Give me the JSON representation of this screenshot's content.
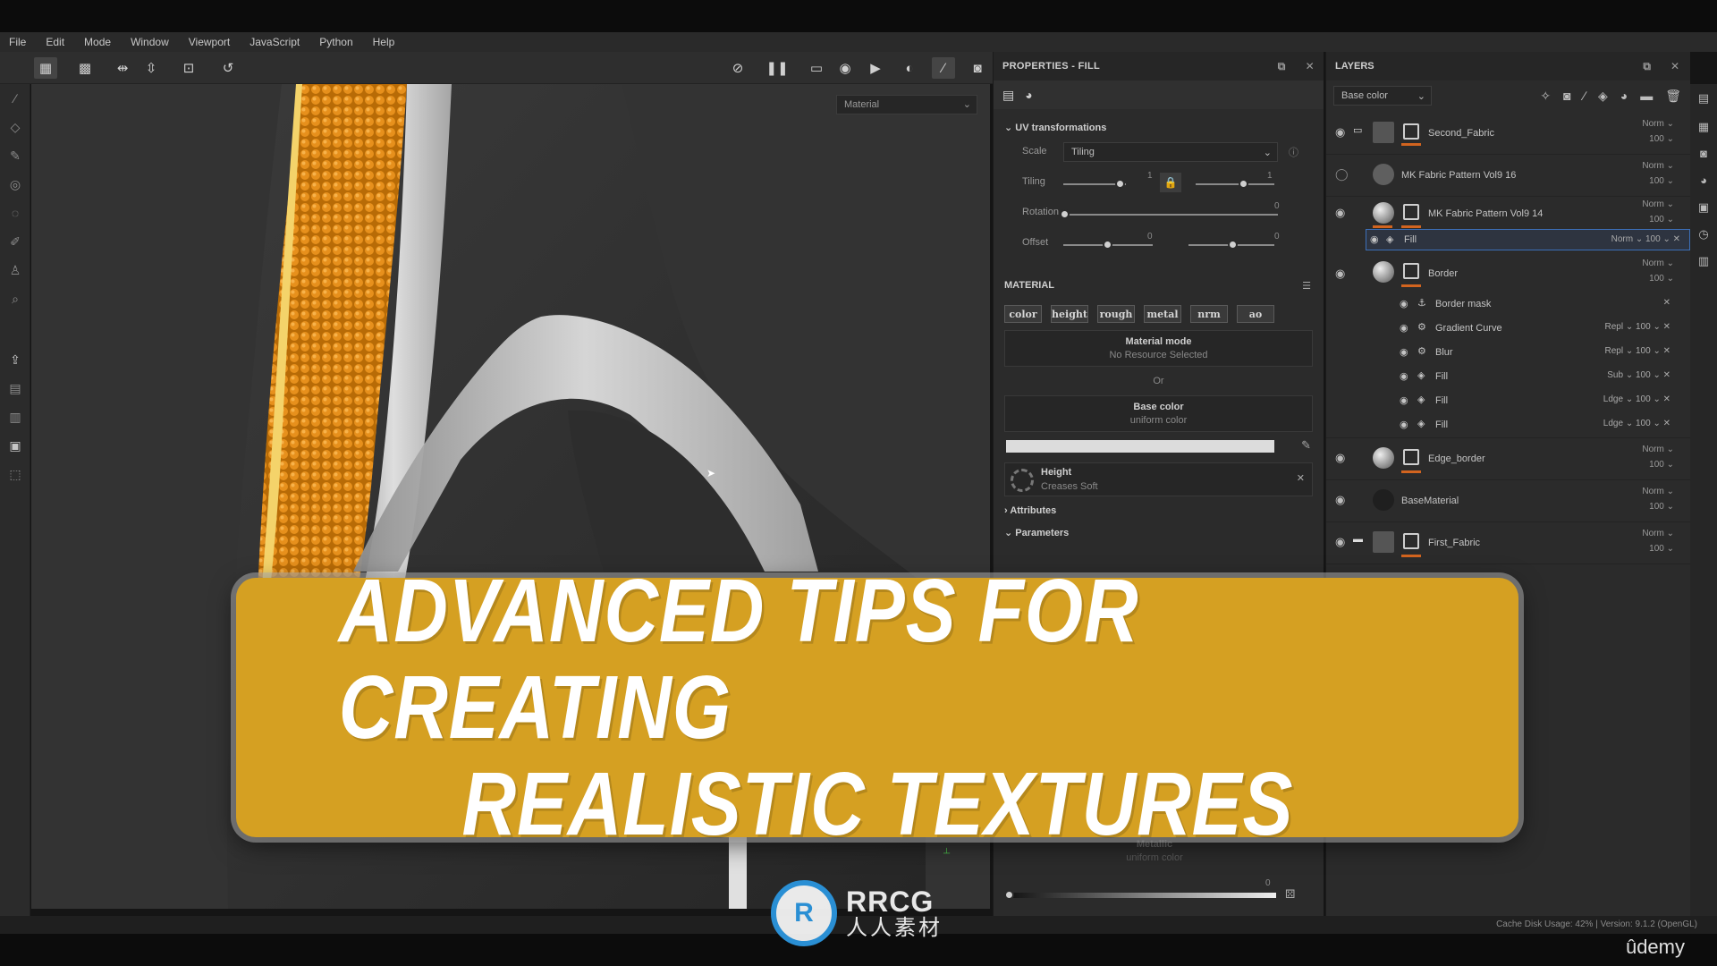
{
  "menu": [
    "File",
    "Edit",
    "Mode",
    "Window",
    "Viewport",
    "JavaScript",
    "Python",
    "Help"
  ],
  "viewport": {
    "channel_select": "Material"
  },
  "properties": {
    "title": "PROPERTIES - FILL",
    "uv_section": "UV transformations",
    "scale_label": "Scale",
    "scale_value": "Tiling",
    "tiling_label": "Tiling",
    "tiling_left_value": "1",
    "tiling_right_value": "1",
    "rotation_label": "Rotation",
    "rotation_value": "0",
    "offset_label": "Offset",
    "offset_value_1": "0",
    "offset_value_2": "0",
    "material_section": "MATERIAL",
    "channels": [
      "color",
      "height",
      "rough",
      "metal",
      "nrm",
      "ao"
    ],
    "material_mode_title": "Material mode",
    "material_mode_value": "No Resource Selected",
    "or_label": "Or",
    "base_color_title": "Base color",
    "base_color_value": "uniform color",
    "height_title": "Height",
    "height_value": "Creases Soft",
    "attributes_label": "Attributes",
    "parameters_label": "Parameters",
    "metallic_title": "Metallic",
    "metallic_value": "uniform color",
    "metallic_slider_value": "0"
  },
  "layers": {
    "title": "LAYERS",
    "channel_select": "Base color",
    "items": [
      {
        "name": "Second_Fabric",
        "blend": "Norm",
        "opacity": "100"
      },
      {
        "name": "MK Fabric Pattern Vol9 16",
        "blend": "Norm",
        "opacity": "100"
      },
      {
        "name": "MK Fabric Pattern Vol9 14",
        "blend": "Norm",
        "opacity": "100"
      },
      {
        "name": "Fill",
        "blend": "Norm",
        "opacity": "100"
      },
      {
        "name": "Border",
        "blend": "Norm",
        "opacity": "100"
      },
      {
        "name": "Border mask",
        "blend": "",
        "opacity": ""
      },
      {
        "name": "Gradient Curve",
        "blend": "Repl",
        "opacity": "100"
      },
      {
        "name": "Blur",
        "blend": "Repl",
        "opacity": "100"
      },
      {
        "name": "Fill",
        "blend": "Sub",
        "opacity": "100"
      },
      {
        "name": "Fill",
        "blend": "Ldge",
        "opacity": "100"
      },
      {
        "name": "Fill",
        "blend": "Ldge",
        "opacity": "100"
      },
      {
        "name": "Edge_border",
        "blend": "Norm",
        "opacity": "100"
      },
      {
        "name": "BaseMaterial",
        "blend": "Norm",
        "opacity": "100"
      },
      {
        "name": "First_Fabric",
        "blend": "Norm",
        "opacity": "100"
      }
    ]
  },
  "status": {
    "text": "Cache Disk Usage:    42% | Version: 9.1.2 (OpenGL)"
  },
  "banner": {
    "line1": "ADVANCED TIPS FOR CREATING",
    "line2": "REALISTIC TEXTURES"
  },
  "watermark": {
    "mark": "R",
    "brand": "RRCG",
    "sub": "人人素材"
  },
  "udemy": "ûdemy",
  "colors": {
    "banner": "#d5a022",
    "accent_orange": "#d2641f",
    "watermark_blue": "#2a8fd4"
  }
}
